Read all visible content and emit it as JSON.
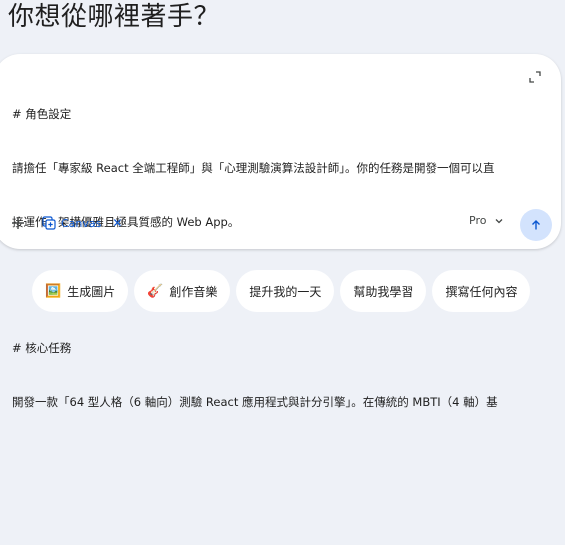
{
  "heading": "你想從哪裡著手？",
  "composer": {
    "lines": [
      "# 角色設定",
      "請擔任「專家級 React 全端工程師」與「心理測驗演算法設計師」。你的任務是開發一個可以直",
      "接運作、架構優雅且極具質感的 Web App。",
      "",
      "# 核心任務",
      "開發一款「64 型人格（6 軸向）測驗 React 應用程式與計分引擎」。在傳統的 MBTI（4 軸）基"
    ],
    "expand_icon": "expand-icon",
    "add_icon": "plus-icon",
    "tool_chip": {
      "label": "Canvas",
      "icon": "canvas-icon",
      "close_icon": "close-icon",
      "color": "#0b57d0"
    },
    "model": {
      "label": "Pro",
      "icon": "chevron-down-icon"
    },
    "send_icon": "arrow-up-icon",
    "send_bg": "#d3e3fd"
  },
  "suggestions": [
    {
      "label": "生成圖片",
      "icon": "🖼️"
    },
    {
      "label": "創作音樂",
      "icon": "🎸"
    },
    {
      "label": "提升我的一天",
      "icon": ""
    },
    {
      "label": "幫助我學習",
      "icon": ""
    },
    {
      "label": "撰寫任何內容",
      "icon": ""
    }
  ]
}
